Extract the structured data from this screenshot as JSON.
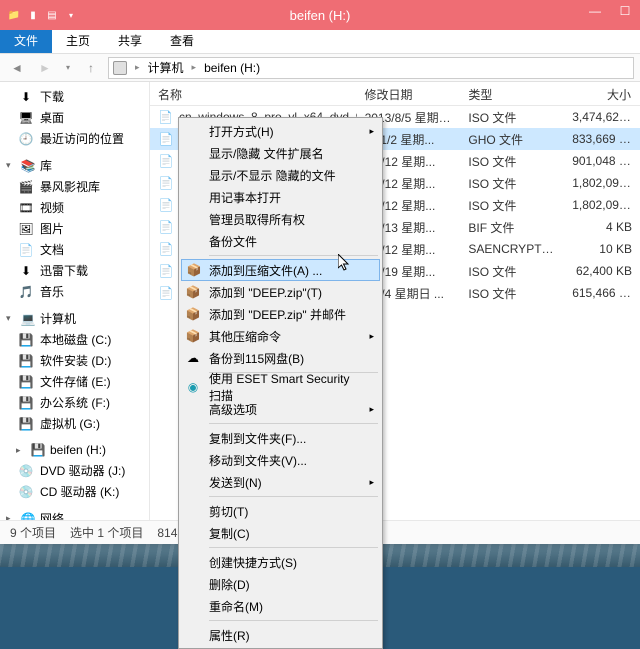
{
  "title": "beifen (H:)",
  "tabs": {
    "file": "文件",
    "home": "主页",
    "share": "共享",
    "view": "查看"
  },
  "breadcrumb": {
    "computer": "计算机",
    "drive": "beifen (H:)"
  },
  "sidebar": {
    "fav": {
      "downloads": "下载",
      "desktop": "桌面",
      "recent": "最近访问的位置"
    },
    "lib_label": "库",
    "lib": {
      "storm": "暴风影视库",
      "videos": "视频",
      "pictures": "图片",
      "docs": "文档",
      "xunlei": "迅雷下载",
      "music": "音乐"
    },
    "comp_label": "计算机",
    "drives": {
      "c": "本地磁盘 (C:)",
      "d": "软件安装 (D:)",
      "e": "文件存储 (E:)",
      "f": "办公系统 (F:)",
      "g": "虚拟机 (G:)",
      "h": "beifen (H:)",
      "j": "DVD 驱动器 (J:)",
      "k": "CD 驱动器 (K:)"
    },
    "net_label": "网络"
  },
  "columns": {
    "name": "名称",
    "date": "修改日期",
    "type": "类型",
    "size": "大小"
  },
  "rows": [
    {
      "name": "cn_windows_8_pro_vl_x64_dvd_91777...",
      "date": "2013/8/5 星期一 ...",
      "type": "ISO 文件",
      "size": "3,474,624..."
    },
    {
      "name": "",
      "date": "2/11/2 星期...",
      "type": "GHO 文件",
      "size": "833,669 KB"
    },
    {
      "name": "",
      "date": "3/8/12 星期...",
      "type": "ISO 文件",
      "size": "901,048 KB"
    },
    {
      "name": "",
      "date": "3/8/12 星期...",
      "type": "ISO 文件",
      "size": "1,802,096..."
    },
    {
      "name": "",
      "date": "3/8/12 星期...",
      "type": "ISO 文件",
      "size": "1,802,096..."
    },
    {
      "name": "",
      "date": "3/8/13 星期...",
      "type": "BIF 文件",
      "size": "4 KB"
    },
    {
      "name": "",
      "date": "3/8/12 星期...",
      "type": "SAENCRYPTEDR...",
      "size": "10 KB"
    },
    {
      "name": "",
      "date": "2/6/19 星期...",
      "type": "ISO 文件",
      "size": "62,400 KB"
    },
    {
      "name": "",
      "date": "3/8/4 星期日 ...",
      "type": "ISO 文件",
      "size": "615,466 KB"
    }
  ],
  "ctx": {
    "open_with": "打开方式(H)",
    "show_ext": "显示/隐藏 文件扩展名",
    "show_hidden": "显示/不显示 隐藏的文件",
    "notepad": "用记事本打开",
    "take_owner": "管理员取得所有权",
    "backup": "备份文件",
    "add_archive": "添加到压缩文件(A) ...",
    "add_deep": "添加到 \"DEEP.zip\"(T)",
    "add_deep_mail": "添加到 \"DEEP.zip\" 并邮件",
    "other_zip": "其他压缩命令",
    "backup_115": "备份到115网盘(B)",
    "eset": "使用 ESET Smart Security 扫描",
    "advanced": "高级选项",
    "copy_to": "复制到文件夹(F)...",
    "move_to": "移动到文件夹(V)...",
    "send_to": "发送到(N)",
    "cut": "剪切(T)",
    "copy": "复制(C)",
    "shortcut": "创建快捷方式(S)",
    "delete": "删除(D)",
    "rename": "重命名(M)",
    "properties": "属性(R)"
  },
  "status": {
    "count": "9 个项目",
    "selected": "选中 1 个项目",
    "size": "814 M"
  }
}
